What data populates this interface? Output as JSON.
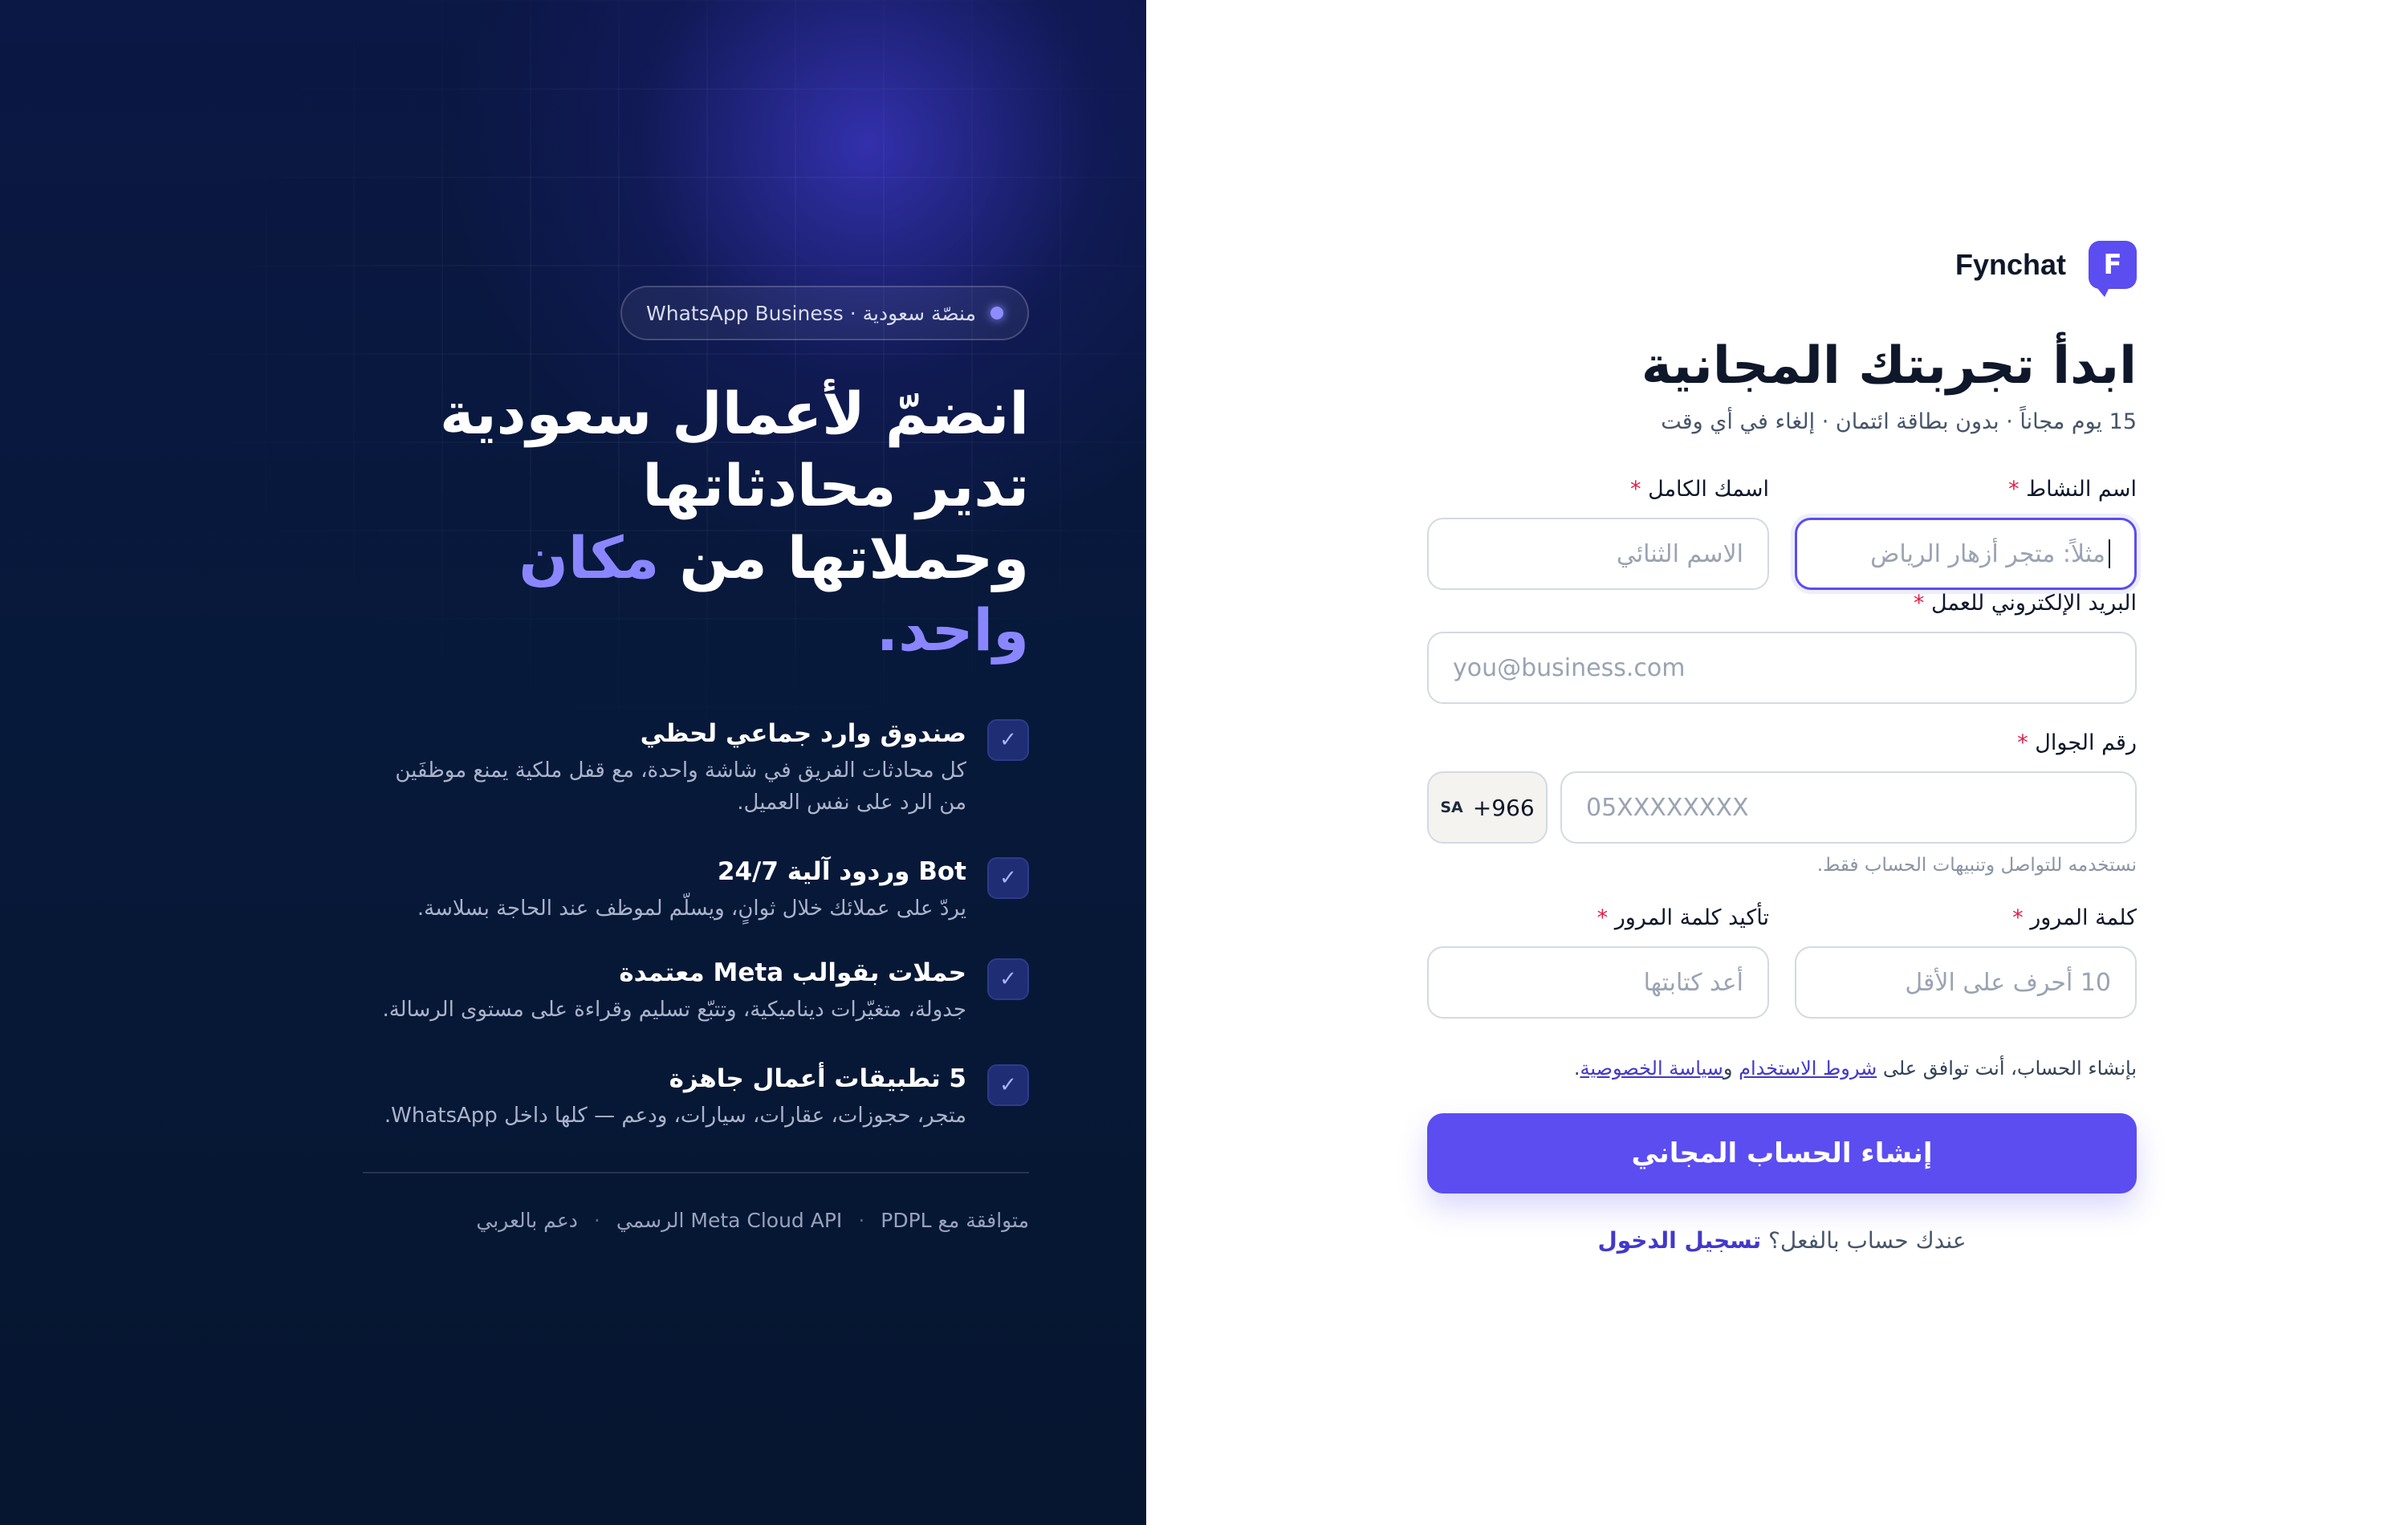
{
  "hero": {
    "badge": "منصّة سعودية · WhatsApp Business",
    "title_line1": "انضمّ لأعمال سعودية تدير محادثاتها",
    "title_line2_prefix": "وحملاتها من ",
    "title_line2_accent": "مكان واحد",
    "title_line2_suffix": ".",
    "features": [
      {
        "title": "صندوق وارد جماعي لحظي",
        "description": "كل محادثات الفريق في شاشة واحدة، مع قفل ملكية يمنع موظفَين من الرد على نفس العميل."
      },
      {
        "title": "Bot وردود آلية 24/7",
        "description": "يردّ على عملائك خلال ثوانٍ، ويسلّم لموظف عند الحاجة بسلاسة."
      },
      {
        "title": "حملات بقوالب Meta معتمدة",
        "description": "جدولة، متغيّرات ديناميكية، وتتبّع تسليم وقراءة على مستوى الرسالة."
      },
      {
        "title": "5 تطبيقات أعمال جاهزة",
        "description": "متجر، حجوزات، عقارات، سيارات، ودعم — كلها داخل WhatsApp."
      }
    ],
    "footer": {
      "item1": "متوافقة مع PDPL",
      "item2": "Meta Cloud API الرسمي",
      "item3": "دعم بالعربي",
      "separator": "·"
    },
    "colors": {
      "accent": "#8a86ff",
      "background": "#07193a"
    }
  },
  "form": {
    "brand_name": "Fynchat",
    "brand_logo_letter": "F",
    "title": "ابدأ تجربتك المجانية",
    "subtitle": "15 يوم مجاناً · بدون بطاقة ائتمان · إلغاء في أي وقت",
    "required_mark": "*",
    "business_name": {
      "label": "اسم النشاط",
      "placeholder": "مثلاً: متجر أزهار الرياض"
    },
    "full_name": {
      "label": "اسمك الكامل",
      "placeholder": "الاسم الثنائي"
    },
    "email": {
      "label": "البريد الإلكتروني للعمل",
      "placeholder": "you@business.com"
    },
    "phone": {
      "label": "رقم الجوال",
      "country_flag": "SA",
      "country_code": "+966",
      "placeholder": "05XXXXXXXX",
      "hint": "نستخدمه للتواصل وتنبيهات الحساب فقط."
    },
    "password": {
      "label": "كلمة المرور",
      "placeholder": "10 أحرف على الأقل"
    },
    "confirm_password": {
      "label": "تأكيد كلمة المرور",
      "placeholder": "أعد كتابتها"
    },
    "terms": {
      "prefix": "بإنشاء الحساب، أنت توافق على ",
      "terms_link": "شروط الاستخدام",
      "and": " و",
      "privacy_link": "سياسة الخصوصية",
      "suffix": "."
    },
    "submit_label": "إنشاء الحساب المجاني",
    "login_prompt": "عندك حساب بالفعل؟ ",
    "login_link": "تسجيل الدخول",
    "colors": {
      "primary": "#5b4df0",
      "required": "#e11d48"
    }
  }
}
